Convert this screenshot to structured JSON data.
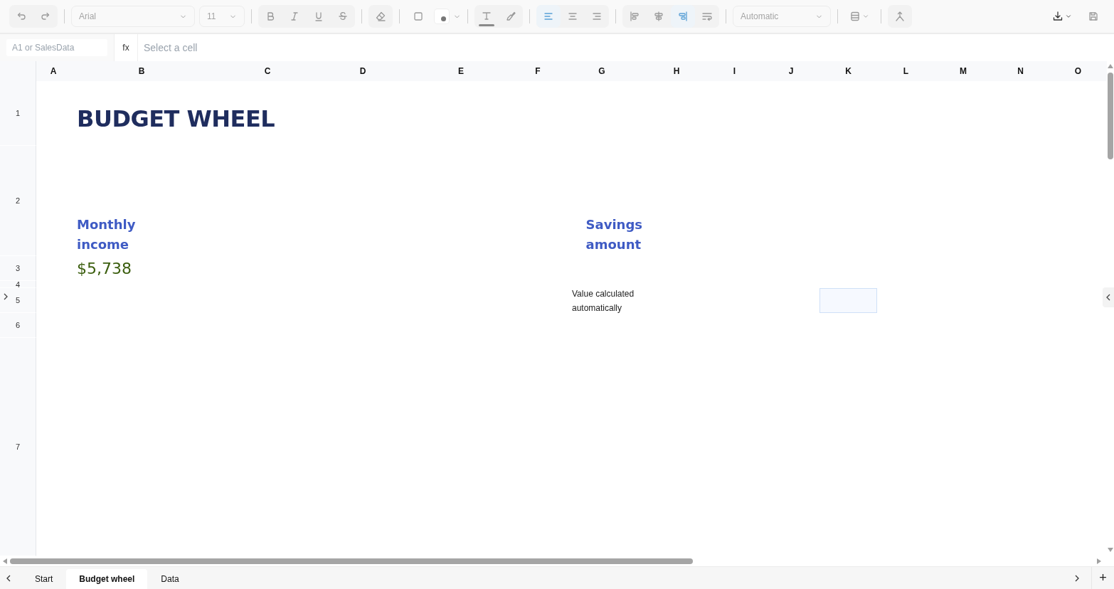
{
  "toolbar": {
    "font": {
      "value": "Arial"
    },
    "size": {
      "value": "11"
    },
    "number_format": {
      "value": "Automatic"
    },
    "horizontal_align": [
      {
        "kind": "left",
        "selected": true
      },
      {
        "kind": "center",
        "selected": false
      },
      {
        "kind": "right",
        "selected": false
      }
    ],
    "vertical_align": [
      {
        "kind": "top",
        "selected": false
      },
      {
        "kind": "middle",
        "selected": false
      },
      {
        "kind": "bottom",
        "selected": true
      },
      {
        "kind": "wrap",
        "selected": false
      }
    ]
  },
  "formula_bar": {
    "name_box": {
      "placeholder": "A1 or SalesData"
    },
    "fx_label": "fx",
    "formula": {
      "placeholder": "Select a cell"
    }
  },
  "columns": [
    "A",
    "B",
    "C",
    "D",
    "E",
    "F",
    "G",
    "H",
    "I",
    "J",
    "K",
    "L",
    "M",
    "N",
    "O"
  ],
  "rows": [
    "1",
    "2",
    "3",
    "4",
    "5",
    "6",
    "7"
  ],
  "cells": [
    {
      "kind": "title",
      "text": "BUDGET WHEEL"
    },
    {
      "kind": "label_left",
      "text": "Monthly income"
    },
    {
      "kind": "amount",
      "text": "$5,738"
    },
    {
      "kind": "label_right",
      "text": "Savings amount"
    },
    {
      "kind": "note",
      "text": "Value calculated automatically"
    },
    {
      "kind": "input"
    }
  ],
  "sheet_tabs": [
    {
      "label": "Start",
      "selected": false
    },
    {
      "label": "Budget wheel",
      "selected": true
    },
    {
      "label": "Data",
      "selected": false
    }
  ],
  "add_sheet": "+"
}
